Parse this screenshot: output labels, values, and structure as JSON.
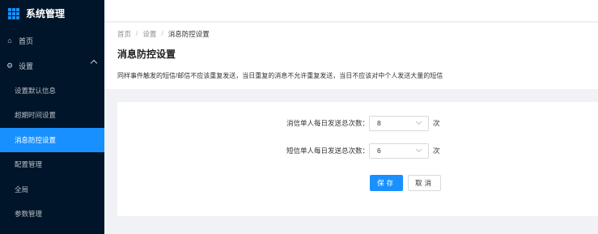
{
  "sidebar": {
    "app_title": "系统管理",
    "items": [
      {
        "label": "首页",
        "icon": "home-icon"
      },
      {
        "label": "设置",
        "icon": "gear-icon",
        "expanded": true
      },
      {
        "label": "设置默认信息"
      },
      {
        "label": "超期时间设置"
      },
      {
        "label": "消息防控设置",
        "active": true
      },
      {
        "label": "配置管理"
      },
      {
        "label": "全局"
      },
      {
        "label": "参数管理"
      }
    ],
    "colors": {
      "background": "#001529",
      "active": "#1890ff"
    }
  },
  "breadcrumb": {
    "items": [
      "首页",
      "设置",
      "消息防控设置"
    ],
    "separator": "/"
  },
  "page": {
    "title": "消息防控设置",
    "description": "同样事件触发的短信/邮信不应该重复发送，当日重复的消息不允许重复发送，当日不应该对中个人发送大量的短信"
  },
  "form": {
    "fields": [
      {
        "label": "消信单人每日发送总次数：",
        "value": "8",
        "unit": "次"
      },
      {
        "label": "短信单人每日发送总次数：",
        "value": "6",
        "unit": "次"
      }
    ],
    "save_label": "保存",
    "cancel_label": "取消"
  }
}
